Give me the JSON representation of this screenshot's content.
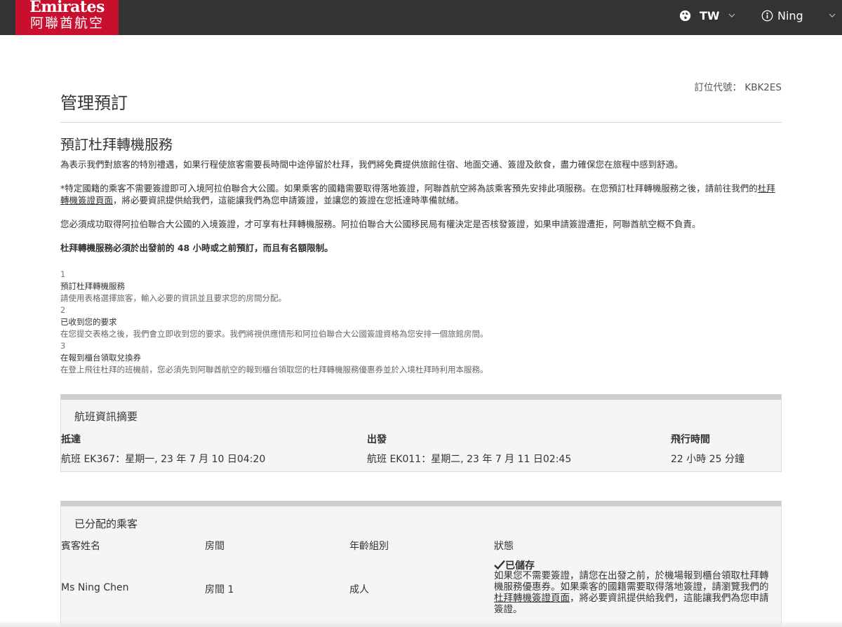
{
  "header": {
    "logo_en": "Emirates",
    "logo_zh": "阿聯酋航空",
    "language_code": "TW",
    "user_name": "Ning",
    "brand_color": "#c8102e",
    "bar_color": "#333333"
  },
  "booking": {
    "pnr_label": "訂位代號：",
    "pnr_value": "KBK2ES",
    "page_title": "管理預訂",
    "section_title": "預訂杜拜轉機服務"
  },
  "intro": {
    "p1": "為表示我們對旅客的特別禮遇，如果行程使旅客需要長時間中途停留於杜拜，我們將免費提供旅館住宿、地面交通、簽證及飲食，盡力確保您在旅程中感到舒適。",
    "p2_before": "*特定國籍的乘客不需要簽證即可入境阿拉伯聯合大公國。如果乘客的國籍需要取得落地簽證，阿聯酋航空將為該乘客預先安排此項服務。在您預訂杜拜轉機服務之後，請前往我們的",
    "p2_link": "杜拜轉機簽證頁面",
    "p2_after": "，將必要資訊提供給我們，這能讓我們為您申請簽證，並讓您的簽證在您抵達時準備就緒。",
    "p3": "您必須成功取得阿拉伯聯合大公國的入境簽證，才可享有杜拜轉機服務。阿拉伯聯合大公國移民局有權決定是否核發簽證，如果申請簽證遭拒，阿聯酋航空概不負責。",
    "p4": "杜拜轉機服務必須於出發前的 48 小時或之前預訂，而且有名額限制。"
  },
  "steps": [
    {
      "num": "1",
      "title": "預訂杜拜轉機服務",
      "desc": "請使用表格選擇旅客，輸入必要的資訊並且要求您的房間分配。"
    },
    {
      "num": "2",
      "title": "已收到您的要求",
      "desc": "在您提交表格之後，我們會立即收到您的要求。我們將視供應情形和阿拉伯聯合大公國簽證資格為您安排一個旅館房間。"
    },
    {
      "num": "3",
      "title": "在報到櫃台領取兌換券",
      "desc": "在登上飛往杜拜的班機前，您必須先到阿聯酋航空的報到櫃台領取您的杜拜轉機服務優惠券並於入境杜拜時利用本服務。"
    }
  ],
  "flight_summary": {
    "title": "航班資訊摘要",
    "arrival_label": "抵達",
    "arrival_value": "航班 EK367：星期一, 23 年 7 月 10 日04:20",
    "departure_label": "出發",
    "departure_value": "航班 EK011：星期二, 23 年 7 月 11 日02:45",
    "duration_label": "飛行時間",
    "duration_value": "22 小時 25 分鐘"
  },
  "passengers": {
    "title": "已分配的乘客",
    "headers": [
      "賓客姓名",
      "房間",
      "年齡組別",
      "狀態"
    ],
    "rows": [
      {
        "name": "Ms Ning Chen",
        "room": "房間 1",
        "age_group": "成人",
        "status": "已儲存",
        "note_before": "如果您不需要簽證，請您在出發之前，於機場報到櫃台領取杜拜轉機服務優惠券。如果乘客的國籍需要取得落地簽證，請瀏覽我們的",
        "note_link": "杜拜轉機簽證頁面",
        "note_after": "，將必要資訊提供給我們，這能讓我們為您申請簽證。"
      }
    ]
  }
}
